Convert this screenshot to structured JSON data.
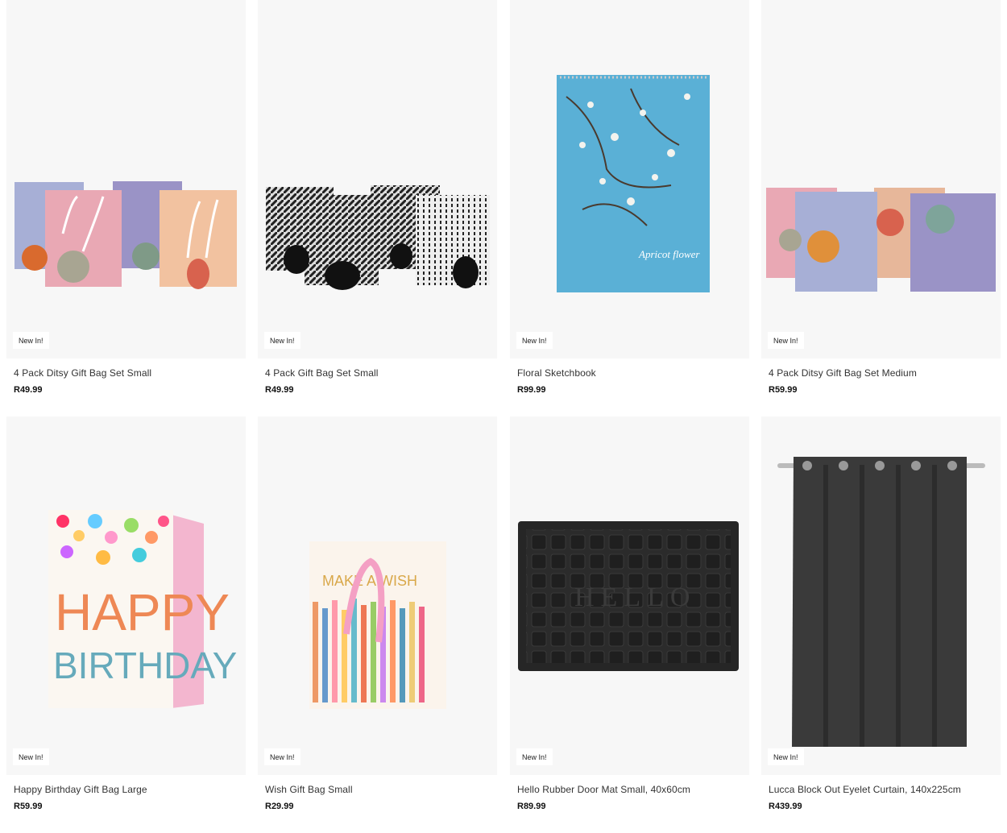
{
  "products": [
    {
      "name": "4 Pack Ditsy Gift Bag Set Small",
      "price": "R49.99",
      "badge": "New In!",
      "image_icon": "ditsy-gift-bags-small-image"
    },
    {
      "name": "4 Pack Gift Bag Set Small",
      "price": "R49.99",
      "badge": "New In!",
      "image_icon": "gift-bags-small-image"
    },
    {
      "name": "Floral Sketchbook",
      "price": "R99.99",
      "badge": "New In!",
      "image_icon": "floral-sketchbook-image",
      "image_text": "Apricot flower"
    },
    {
      "name": "4 Pack Ditsy Gift Bag Set Medium",
      "price": "R59.99",
      "badge": "New In!",
      "image_icon": "ditsy-gift-bags-medium-image"
    },
    {
      "name": "Happy Birthday Gift Bag Large",
      "price": "R59.99",
      "badge": "New In!",
      "image_icon": "birthday-gift-bag-image",
      "image_text_1": "HAPPY",
      "image_text_2": "BIRTHDAY"
    },
    {
      "name": "Wish Gift Bag Small",
      "price": "R29.99",
      "badge": "New In!",
      "image_icon": "wish-gift-bag-image",
      "image_text": "MAKE A WISH"
    },
    {
      "name": "Hello Rubber Door Mat Small, 40x60cm",
      "price": "R89.99",
      "badge": "New In!",
      "image_icon": "door-mat-image",
      "image_text": "HELLO"
    },
    {
      "name": "Lucca Block Out Eyelet Curtain, 140x225cm",
      "price": "R439.99",
      "badge": "New In!",
      "image_icon": "curtain-image"
    }
  ],
  "colors": {
    "card_bg": "#f7f7f7",
    "badge_bg": "#ffffff"
  }
}
